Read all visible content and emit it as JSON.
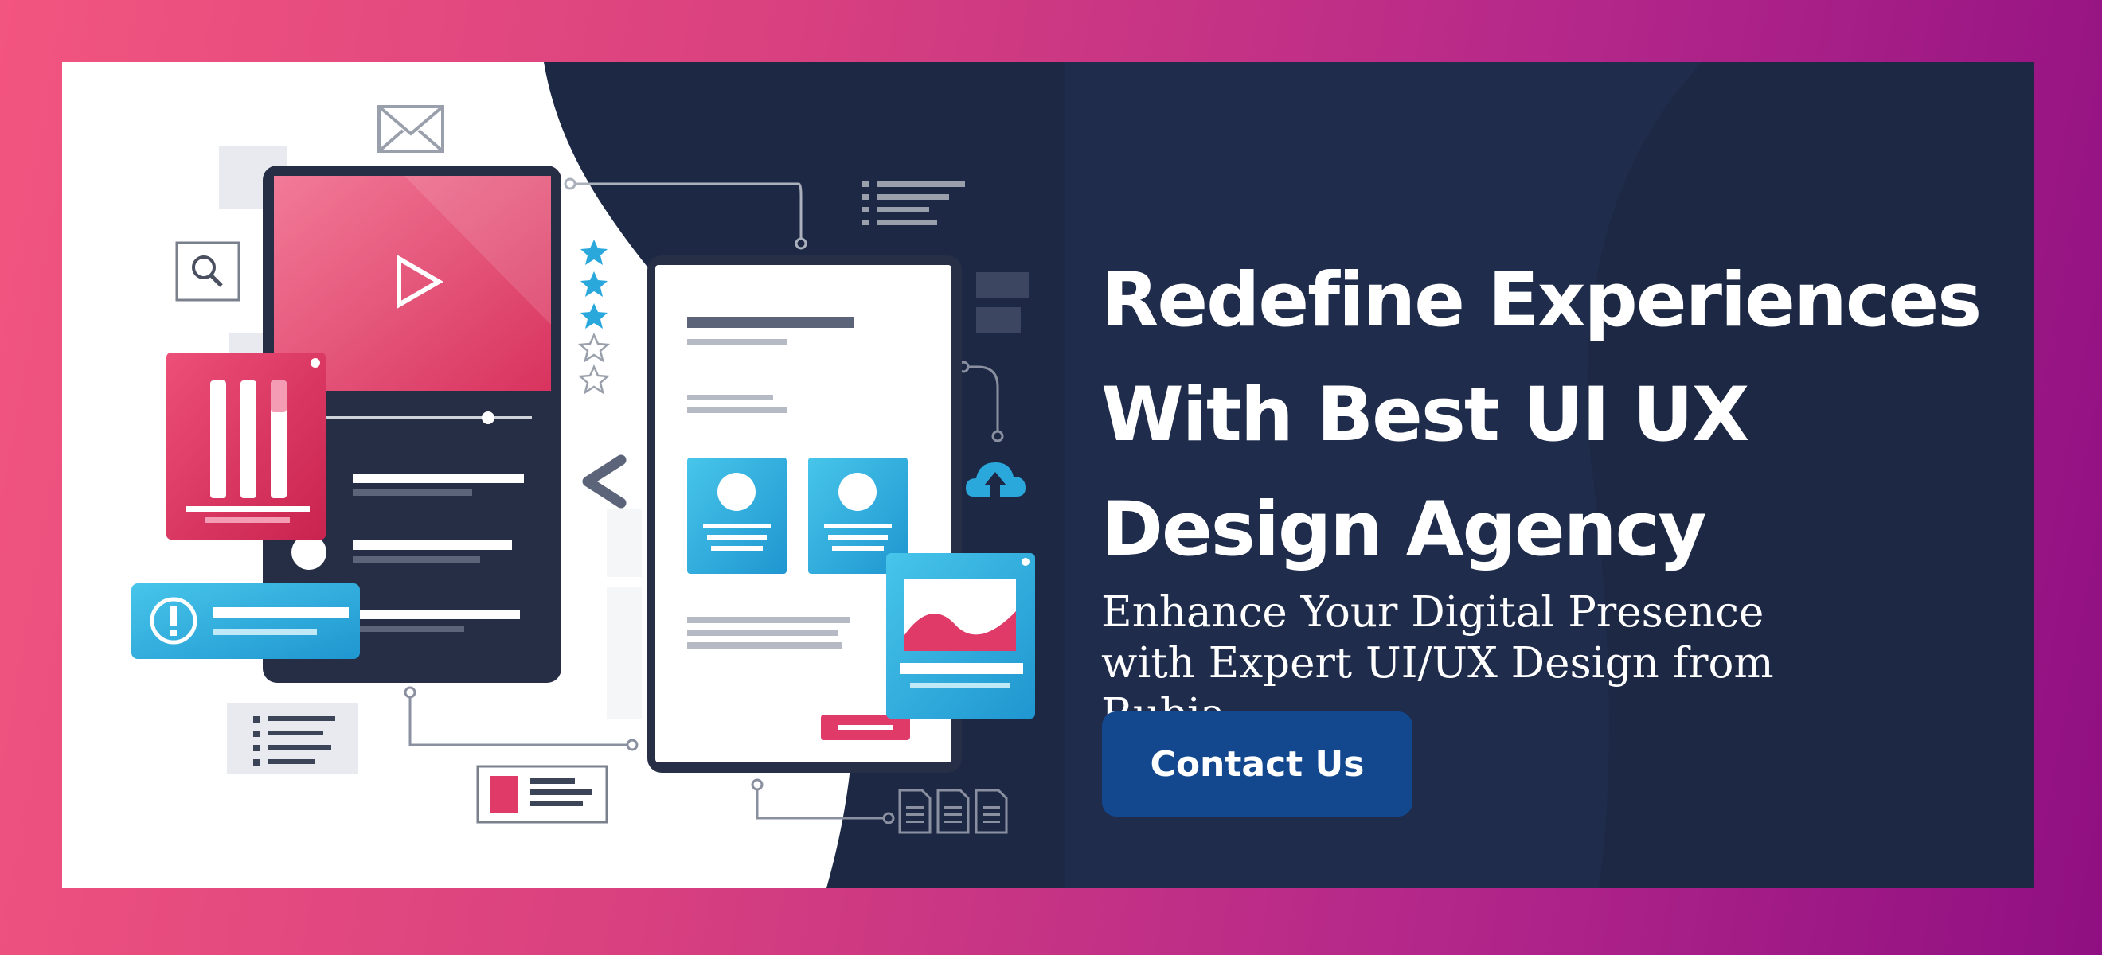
{
  "banner": {
    "headline": "Redefine Experiences With Best UI UX Design Agency",
    "subheadline": "Enhance Your Digital Presence with Expert UI/UX Design from Rubia",
    "cta_label": "Contact Us"
  },
  "illustration": {
    "icons": [
      "envelope-icon",
      "search-icon",
      "play-icon",
      "star-icon",
      "chevron-left-icon",
      "cloud-upload-icon",
      "alert-icon",
      "document-icon"
    ],
    "rating_stars": {
      "filled": 3,
      "total": 5
    }
  },
  "colors": {
    "background_gradient_start": "#f2557f",
    "background_gradient_end": "#8f0f82",
    "panel_dark": "#1c2844",
    "accent_pink": "#e03a68",
    "accent_cyan": "#2aa8dc",
    "button": "#13488f"
  }
}
